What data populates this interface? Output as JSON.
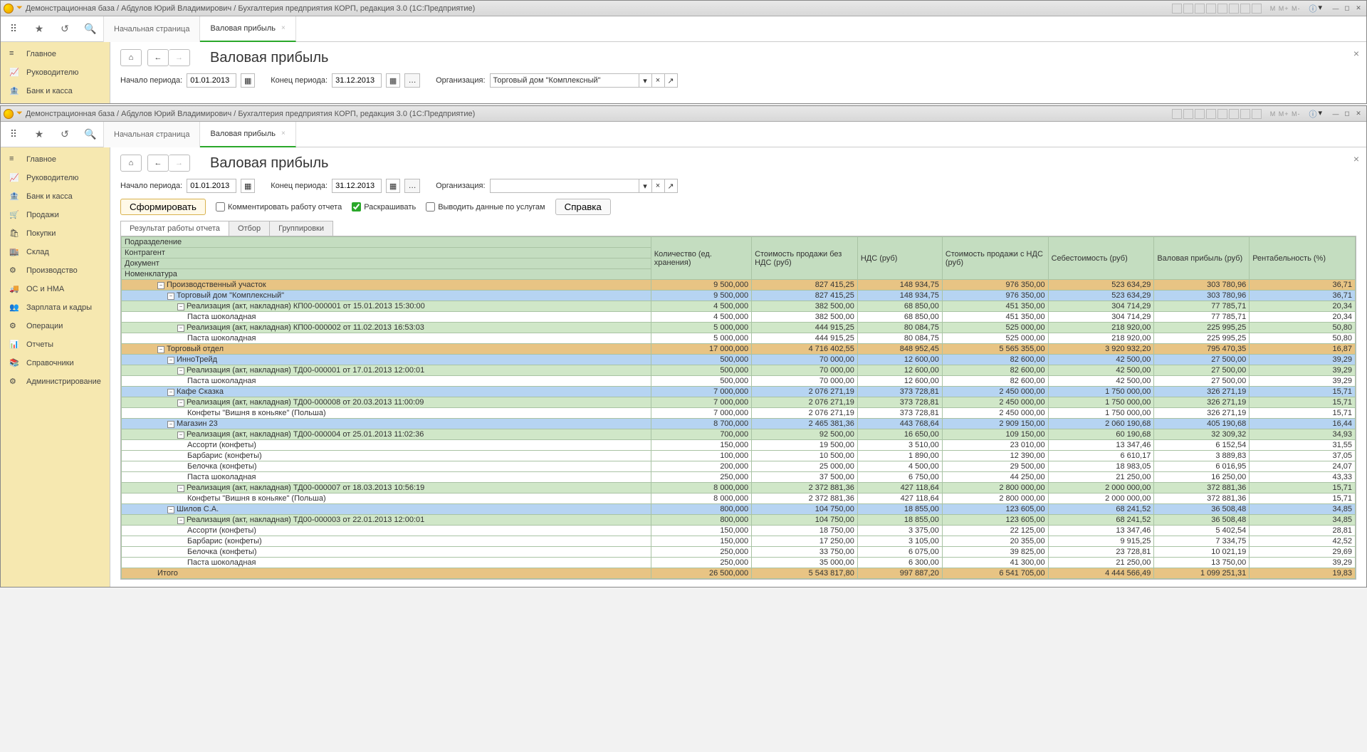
{
  "titlebar": "Демонстрационная база / Абдулов Юрий Владимирович / Бухгалтерия предприятия КОРП, редакция 3.0  (1С:Предприятие)",
  "mem": "M   M+  M-",
  "tabs": {
    "start": "Начальная страница",
    "active": "Валовая прибыль"
  },
  "sidebar": [
    "Главное",
    "Руководителю",
    "Банк и касса",
    "Продажи",
    "Покупки",
    "Склад",
    "Производство",
    "ОС и НМА",
    "Зарплата и кадры",
    "Операции",
    "Отчеты",
    "Справочники",
    "Администрирование"
  ],
  "sidebar_short": [
    "Главное",
    "Руководителю",
    "Банк и касса"
  ],
  "page_title": "Валовая прибыль",
  "labels": {
    "period_start": "Начало периода:",
    "period_end": "Конец периода:",
    "org": "Организация:",
    "form": "Сформировать",
    "comment": "Комментировать работу отчета",
    "colorize": "Раскрашивать",
    "services": "Выводить данные по услугам",
    "help": "Справка"
  },
  "period_start": "01.01.2013",
  "period_end": "31.12.2013",
  "org_top": "Торговый дом \"Комплексный\"",
  "subtabs": [
    "Результат работы отчета",
    "Отбор",
    "Группировки"
  ],
  "headers": {
    "multi": [
      "Подразделение",
      "Контрагент",
      "Документ",
      "Номенклатура"
    ],
    "qty": "Количество (ед. хранения)",
    "cost_no_vat": "Стоимость продажи без НДС (руб)",
    "vat": "НДС (руб)",
    "cost_vat": "Стоимость продажи с НДС (руб)",
    "cogs": "Себестоимость (руб)",
    "gross": "Валовая прибыль (руб)",
    "rent": "Рентабельность (%)"
  },
  "rows": [
    {
      "lvl": 0,
      "t": "Производственный участок",
      "v": [
        "9 500,000",
        "827 415,25",
        "148 934,75",
        "976 350,00",
        "523 634,29",
        "303 780,96",
        "36,71"
      ]
    },
    {
      "lvl": 1,
      "t": "Торговый дом \"Комплексный\"",
      "v": [
        "9 500,000",
        "827 415,25",
        "148 934,75",
        "976 350,00",
        "523 634,29",
        "303 780,96",
        "36,71"
      ]
    },
    {
      "lvl": 2,
      "t": "Реализация (акт, накладная) КП00-000001 от 15.01.2013 15:30:00",
      "v": [
        "4 500,000",
        "382 500,00",
        "68 850,00",
        "451 350,00",
        "304 714,29",
        "77 785,71",
        "20,34"
      ]
    },
    {
      "lvl": 3,
      "t": "Паста шоколадная",
      "v": [
        "4 500,000",
        "382 500,00",
        "68 850,00",
        "451 350,00",
        "304 714,29",
        "77 785,71",
        "20,34"
      ]
    },
    {
      "lvl": 2,
      "t": "Реализация (акт, накладная) КП00-000002 от 11.02.2013 16:53:03",
      "v": [
        "5 000,000",
        "444 915,25",
        "80 084,75",
        "525 000,00",
        "218 920,00",
        "225 995,25",
        "50,80"
      ]
    },
    {
      "lvl": 3,
      "t": "Паста шоколадная",
      "v": [
        "5 000,000",
        "444 915,25",
        "80 084,75",
        "525 000,00",
        "218 920,00",
        "225 995,25",
        "50,80"
      ]
    },
    {
      "lvl": 0,
      "t": "Торговый отдел",
      "v": [
        "17 000,000",
        "4 716 402,55",
        "848 952,45",
        "5 565 355,00",
        "3 920 932,20",
        "795 470,35",
        "16,87"
      ]
    },
    {
      "lvl": 1,
      "t": "ИнноТрейд",
      "v": [
        "500,000",
        "70 000,00",
        "12 600,00",
        "82 600,00",
        "42 500,00",
        "27 500,00",
        "39,29"
      ]
    },
    {
      "lvl": 2,
      "t": "Реализация (акт, накладная) ТД00-000001 от 17.01.2013 12:00:01",
      "v": [
        "500,000",
        "70 000,00",
        "12 600,00",
        "82 600,00",
        "42 500,00",
        "27 500,00",
        "39,29"
      ]
    },
    {
      "lvl": 3,
      "t": "Паста шоколадная",
      "v": [
        "500,000",
        "70 000,00",
        "12 600,00",
        "82 600,00",
        "42 500,00",
        "27 500,00",
        "39,29"
      ]
    },
    {
      "lvl": 1,
      "t": "Кафе Сказка",
      "v": [
        "7 000,000",
        "2 076 271,19",
        "373 728,81",
        "2 450 000,00",
        "1 750 000,00",
        "326 271,19",
        "15,71"
      ]
    },
    {
      "lvl": 2,
      "t": "Реализация (акт, накладная) ТД00-000008 от 20.03.2013 11:00:09",
      "v": [
        "7 000,000",
        "2 076 271,19",
        "373 728,81",
        "2 450 000,00",
        "1 750 000,00",
        "326 271,19",
        "15,71"
      ]
    },
    {
      "lvl": 3,
      "t": "Конфеты \"Вишня в коньяке\"  (Польша)",
      "v": [
        "7 000,000",
        "2 076 271,19",
        "373 728,81",
        "2 450 000,00",
        "1 750 000,00",
        "326 271,19",
        "15,71"
      ]
    },
    {
      "lvl": 1,
      "t": "Магазин 23",
      "v": [
        "8 700,000",
        "2 465 381,36",
        "443 768,64",
        "2 909 150,00",
        "2 060 190,68",
        "405 190,68",
        "16,44"
      ]
    },
    {
      "lvl": 2,
      "t": "Реализация (акт, накладная) ТД00-000004 от 25.01.2013 11:02:36",
      "v": [
        "700,000",
        "92 500,00",
        "16 650,00",
        "109 150,00",
        "60 190,68",
        "32 309,32",
        "34,93"
      ]
    },
    {
      "lvl": 3,
      "t": "Ассорти (конфеты)",
      "v": [
        "150,000",
        "19 500,00",
        "3 510,00",
        "23 010,00",
        "13 347,46",
        "6 152,54",
        "31,55"
      ]
    },
    {
      "lvl": 3,
      "t": "Барбарис (конфеты)",
      "v": [
        "100,000",
        "10 500,00",
        "1 890,00",
        "12 390,00",
        "6 610,17",
        "3 889,83",
        "37,05"
      ]
    },
    {
      "lvl": 3,
      "t": "Белочка (конфеты)",
      "v": [
        "200,000",
        "25 000,00",
        "4 500,00",
        "29 500,00",
        "18 983,05",
        "6 016,95",
        "24,07"
      ]
    },
    {
      "lvl": 3,
      "t": "Паста шоколадная",
      "v": [
        "250,000",
        "37 500,00",
        "6 750,00",
        "44 250,00",
        "21 250,00",
        "16 250,00",
        "43,33"
      ]
    },
    {
      "lvl": 2,
      "t": "Реализация (акт, накладная) ТД00-000007 от 18.03.2013 10:56:19",
      "v": [
        "8 000,000",
        "2 372 881,36",
        "427 118,64",
        "2 800 000,00",
        "2 000 000,00",
        "372 881,36",
        "15,71"
      ]
    },
    {
      "lvl": 3,
      "t": "Конфеты \"Вишня в коньяке\"  (Польша)",
      "v": [
        "8 000,000",
        "2 372 881,36",
        "427 118,64",
        "2 800 000,00",
        "2 000 000,00",
        "372 881,36",
        "15,71"
      ]
    },
    {
      "lvl": 1,
      "t": "Шилов С.А.",
      "v": [
        "800,000",
        "104 750,00",
        "18 855,00",
        "123 605,00",
        "68 241,52",
        "36 508,48",
        "34,85"
      ]
    },
    {
      "lvl": 2,
      "t": "Реализация (акт, накладная) ТД00-000003 от 22.01.2013 12:00:01",
      "v": [
        "800,000",
        "104 750,00",
        "18 855,00",
        "123 605,00",
        "68 241,52",
        "36 508,48",
        "34,85"
      ]
    },
    {
      "lvl": 3,
      "t": "Ассорти (конфеты)",
      "v": [
        "150,000",
        "18 750,00",
        "3 375,00",
        "22 125,00",
        "13 347,46",
        "5 402,54",
        "28,81"
      ]
    },
    {
      "lvl": 3,
      "t": "Барбарис (конфеты)",
      "v": [
        "150,000",
        "17 250,00",
        "3 105,00",
        "20 355,00",
        "9 915,25",
        "7 334,75",
        "42,52"
      ]
    },
    {
      "lvl": 3,
      "t": "Белочка (конфеты)",
      "v": [
        "250,000",
        "33 750,00",
        "6 075,00",
        "39 825,00",
        "23 728,81",
        "10 021,19",
        "29,69"
      ]
    },
    {
      "lvl": 3,
      "t": "Паста шоколадная",
      "v": [
        "250,000",
        "35 000,00",
        "6 300,00",
        "41 300,00",
        "21 250,00",
        "13 750,00",
        "39,29"
      ]
    }
  ],
  "total": {
    "label": "Итого",
    "v": [
      "26 500,000",
      "5 543 817,80",
      "997 887,20",
      "6 541 705,00",
      "4 444 566,49",
      "1 099 251,31",
      "19,83"
    ]
  }
}
